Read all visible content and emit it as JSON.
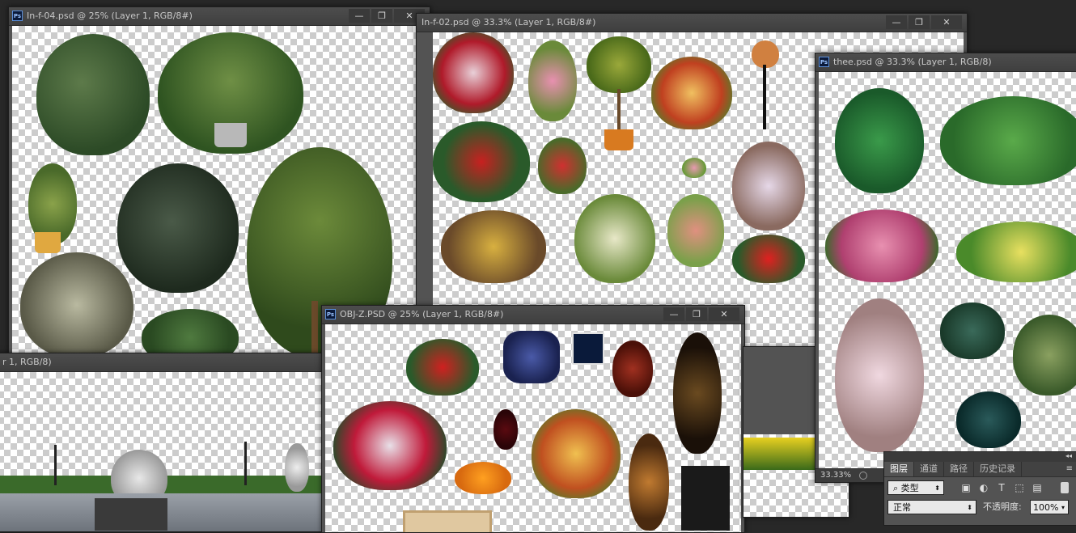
{
  "windows": {
    "w1": {
      "title": "In-f-04.psd @ 25% (Layer 1, RGB/8#)"
    },
    "w2": {
      "title": "In-f-02.psd @ 33.3% (Layer 1, RGB/8#)"
    },
    "w3": {
      "title": "thee.psd @ 33.3% (Layer 1, RGB/8)",
      "zoom": "33.33%"
    },
    "w4": {
      "title": "OBJ-Z.PSD @ 25% (Layer 1, RGB/8#)"
    },
    "w5": {
      "title": "r 1, RGB/8)"
    }
  },
  "controls": {
    "minimize": "—",
    "restore": "❐",
    "close": "✕"
  },
  "app": {
    "icon_label": "Ps"
  },
  "layers_panel": {
    "tabs": [
      "图层",
      "通道",
      "路径",
      "历史记录"
    ],
    "active_tab": 0,
    "filter_kind": "类型",
    "blend_mode": "正常",
    "opacity_label": "不透明度:",
    "opacity_value": "100%"
  },
  "icons": {
    "menu": "panel-menu-icon",
    "filter": "search-icon",
    "image": "image-filter-icon",
    "adjust": "adjustment-filter-icon",
    "type": "type-filter-icon",
    "shape": "shape-filter-icon",
    "smart": "smart-object-filter-icon"
  },
  "colors": {
    "chrome": "#535353",
    "titlebar": "#424242",
    "workspace": "#282828",
    "ps_blue": "#5b8fd9"
  }
}
